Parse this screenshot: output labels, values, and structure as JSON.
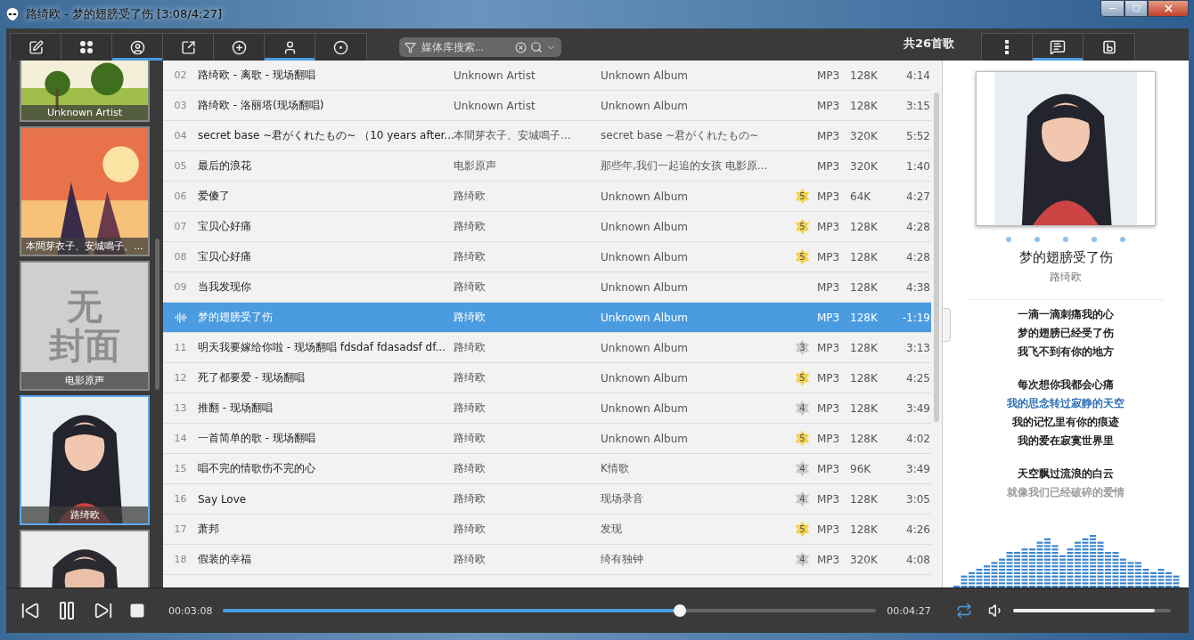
{
  "window": {
    "title": "路绮欧 - 梦的翅膀受了伤 [3:08/4:27]"
  },
  "toolbar": {
    "tabs": [
      {
        "selected": false
      },
      {
        "selected": false
      },
      {
        "selected": true
      },
      {
        "selected": false
      },
      {
        "selected": false
      },
      {
        "selected": true
      },
      {
        "selected": false
      }
    ],
    "search": {
      "placeholder": "媒体库搜索..."
    },
    "song_count": "共26首歌",
    "side_tabs": [
      {
        "selected": false
      },
      {
        "selected": true
      },
      {
        "selected": false
      }
    ]
  },
  "albums": [
    {
      "kind": "picture",
      "label": "Unknown Artist",
      "selected": false
    },
    {
      "kind": "picture",
      "label": "本間芽衣子、安城鳴子、...",
      "selected": false
    },
    {
      "kind": "no_cover",
      "cover_text": [
        "无",
        "封面"
      ],
      "label": "电影原声",
      "selected": false
    },
    {
      "kind": "picture",
      "label": "路绮欧",
      "selected": true
    },
    {
      "kind": "picture",
      "selected": false
    }
  ],
  "songs": [
    {
      "number": "02",
      "title": "路绮欧 - 离歌 - 现场翻唱",
      "artist": "Unknown Artist",
      "album": "Unknown Album",
      "format": "MP3",
      "bitrate": "128K",
      "duration": "4:14",
      "selected": false,
      "playing": false
    },
    {
      "number": "03",
      "title": "路绮欧 - 洛丽塔(现场翻唱)",
      "artist": "Unknown Artist",
      "album": "Unknown Album",
      "format": "MP3",
      "bitrate": "128K",
      "duration": "3:15",
      "selected": false,
      "playing": false
    },
    {
      "number": "04",
      "title": "secret base ~君がくれたもの~ （10 years after...",
      "artist": "本間芽衣子、安城鳴子...",
      "album": "secret base ~君がくれたもの~",
      "format": "MP3",
      "bitrate": "320K",
      "duration": "5:52",
      "selected": false,
      "playing": false
    },
    {
      "number": "05",
      "title": "最后的浪花",
      "artist": "电影原声",
      "album": "那些年,我们一起追的女孩 电影原...",
      "format": "MP3",
      "bitrate": "320K",
      "duration": "1:40",
      "selected": false,
      "playing": false
    },
    {
      "number": "06",
      "title": "爱傻了",
      "artist": "路绮欧",
      "album": "Unknown Album",
      "rating": "5",
      "color": "#f3d24a",
      "format": "MP3",
      "bitrate": "64K",
      "duration": "4:27",
      "selected": false,
      "playing": false
    },
    {
      "number": "07",
      "title": "宝贝心好痛",
      "artist": "路绮欧",
      "album": "Unknown Album",
      "rating": "5",
      "color": "#f3d24a",
      "format": "MP3",
      "bitrate": "128K",
      "duration": "4:28",
      "selected": false,
      "playing": false
    },
    {
      "number": "08",
      "title": "宝贝心好痛",
      "artist": "路绮欧",
      "album": "Unknown Album",
      "rating": "5",
      "color": "#f3d24a",
      "format": "MP3",
      "bitrate": "128K",
      "duration": "4:28",
      "selected": false,
      "playing": false
    },
    {
      "number": "09",
      "title": "当我发现你",
      "artist": "路绮欧",
      "album": "Unknown Album",
      "format": "MP3",
      "bitrate": "128K",
      "duration": "4:38",
      "selected": false,
      "playing": false
    },
    {
      "title": "梦的翅膀受了伤",
      "artist": "路绮欧",
      "album": "Unknown Album",
      "format": "MP3",
      "bitrate": "128K",
      "duration": "-1:19",
      "selected": true,
      "playing": true
    },
    {
      "number": "11",
      "title": "明天我要嫁给你啦 - 现场翻唱 fdsdaf fdasadsf df...",
      "artist": "路绮欧",
      "album": "Unknown Album",
      "rating": "3",
      "color": "#c9c9c9",
      "format": "MP3",
      "bitrate": "128K",
      "duration": "3:13",
      "selected": false,
      "playing": false
    },
    {
      "number": "12",
      "title": "死了都要爱 - 现场翻唱",
      "artist": "路绮欧",
      "album": "Unknown Album",
      "rating": "5",
      "color": "#f3d24a",
      "format": "MP3",
      "bitrate": "128K",
      "duration": "4:25",
      "selected": false,
      "playing": false
    },
    {
      "number": "13",
      "title": "推翻 - 现场翻唱",
      "artist": "路绮欧",
      "album": "Unknown Album",
      "rating": "4",
      "color": "#c9c9c9",
      "format": "MP3",
      "bitrate": "128K",
      "duration": "3:49",
      "selected": false,
      "playing": false
    },
    {
      "number": "14",
      "title": "一首简单的歌 - 现场翻唱",
      "artist": "路绮欧",
      "album": "Unknown Album",
      "rating": "5",
      "color": "#f3d24a",
      "format": "MP3",
      "bitrate": "128K",
      "duration": "4:02",
      "selected": false,
      "playing": false
    },
    {
      "number": "15",
      "title": "唱不完的情歌伤不完的心",
      "artist": "路绮欧",
      "album": "K情歌",
      "rating": "4",
      "color": "#c9c9c9",
      "format": "MP3",
      "bitrate": "96K",
      "duration": "3:49",
      "selected": false,
      "playing": false
    },
    {
      "number": "16",
      "title": "Say Love",
      "artist": "路绮欧",
      "album": "现场录音",
      "rating": "4",
      "color": "#c9c9c9",
      "format": "MP3",
      "bitrate": "128K",
      "duration": "3:05",
      "selected": false,
      "playing": false
    },
    {
      "number": "17",
      "title": "萧邦",
      "artist": "路绮欧",
      "album": "发现",
      "rating": "5",
      "color": "#f3d24a",
      "format": "MP3",
      "bitrate": "128K",
      "duration": "4:26",
      "selected": false,
      "playing": false
    },
    {
      "number": "18",
      "title": "假装的幸福",
      "artist": "路绮欧",
      "album": "绮有独钟",
      "rating": "4",
      "color": "#c9c9c9",
      "format": "MP3",
      "bitrate": "320K",
      "duration": "4:08",
      "selected": false,
      "playing": false
    }
  ],
  "now_playing": {
    "kind": "picture",
    "title": "梦的翅膀受了伤",
    "artist": "路绮欧"
  },
  "lyrics": [
    [
      {
        "text": "一滴一滴刺痛我的心",
        "current": false
      },
      {
        "text": "梦的翅膀已经受了伤",
        "current": false
      },
      {
        "text": "我飞不到有你的地方",
        "current": false
      }
    ],
    [
      {
        "text": "每次想你我都会心痛",
        "current": false
      },
      {
        "text": "我的思念转过寂静的天空",
        "current": true
      },
      {
        "text": "我的记忆里有你的痕迹",
        "current": false
      },
      {
        "text": "我的爱在寂寞世界里",
        "current": false
      }
    ],
    [
      {
        "text": "天空飘过流浪的白云",
        "current": false
      },
      {
        "text": "就像我们已经破碎的爱情",
        "current": false
      }
    ]
  ],
  "player": {
    "elapsed": "00:03:08",
    "total": "00:04:27",
    "progress": {
      "level": 0.7
    },
    "repeat_on": true,
    "volume": {
      "level": 0.9
    }
  }
}
